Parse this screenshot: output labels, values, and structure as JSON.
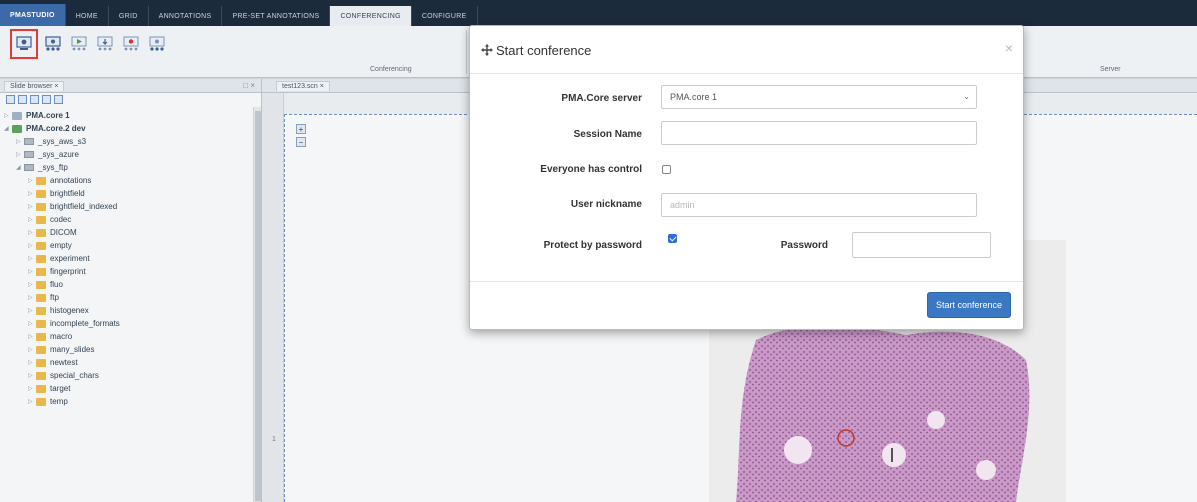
{
  "menu": {
    "brand": "PMASTUDIO",
    "tabs": [
      "HOME",
      "GRID",
      "ANNOTATIONS",
      "PRE-SET ANNOTATIONS",
      "CONFERENCING",
      "CONFIGURE"
    ],
    "active_tab": "CONFERENCING"
  },
  "ribbon": {
    "group_label": "Conferencing",
    "server_label": "Server",
    "buttons": [
      "start-conference-icon",
      "join-conference-icon",
      "present-icon",
      "follow-icon",
      "record-icon",
      "participants-icon"
    ]
  },
  "slide_browser": {
    "tab_label": "Slide browser",
    "close": "×",
    "panel_ctrl": "□ ×",
    "tree": [
      {
        "label": "PMA.core 1",
        "kind": "server",
        "level": 0,
        "bold": true,
        "expanded": false
      },
      {
        "label": "PMA.core.2 dev",
        "kind": "server-green",
        "level": 0,
        "bold": true,
        "expanded": true
      },
      {
        "label": "_sys_aws_s3",
        "kind": "drive",
        "level": 1
      },
      {
        "label": "_sys_azure",
        "kind": "drive",
        "level": 1
      },
      {
        "label": "_sys_ftp",
        "kind": "drive",
        "level": 1,
        "expanded": true
      },
      {
        "label": "annotations",
        "kind": "folder",
        "level": 2
      },
      {
        "label": "brightfield",
        "kind": "folder",
        "level": 2
      },
      {
        "label": "brightfield_indexed",
        "kind": "folder",
        "level": 2
      },
      {
        "label": "codec",
        "kind": "folder",
        "level": 2
      },
      {
        "label": "DICOM",
        "kind": "folder",
        "level": 2
      },
      {
        "label": "empty",
        "kind": "folder",
        "level": 2
      },
      {
        "label": "experiment",
        "kind": "folder",
        "level": 2
      },
      {
        "label": "fingerprint",
        "kind": "folder",
        "level": 2
      },
      {
        "label": "fluo",
        "kind": "folder",
        "level": 2
      },
      {
        "label": "ftp",
        "kind": "folder",
        "level": 2
      },
      {
        "label": "histogenex",
        "kind": "folder",
        "level": 2
      },
      {
        "label": "incomplete_formats",
        "kind": "folder",
        "level": 2
      },
      {
        "label": "macro",
        "kind": "folder",
        "level": 2
      },
      {
        "label": "many_slides",
        "kind": "folder",
        "level": 2
      },
      {
        "label": "newtest",
        "kind": "folder",
        "level": 2
      },
      {
        "label": "special_chars",
        "kind": "folder",
        "level": 2
      },
      {
        "label": "target",
        "kind": "folder",
        "level": 2
      },
      {
        "label": "temp",
        "kind": "folder",
        "level": 2
      }
    ]
  },
  "viewer": {
    "tab_label": "test123.scn",
    "zoom_in": "+",
    "zoom_out": "−",
    "ruler_mark": "1"
  },
  "modal": {
    "title": "Start conference",
    "close": "×",
    "server_label": "PMA.Core server",
    "server_value": "PMA.core 1",
    "session_label": "Session Name",
    "session_value": "",
    "control_label": "Everyone has control",
    "control_checked": false,
    "nickname_label": "User nickname",
    "nickname_placeholder": "admin",
    "protect_label": "Protect by password",
    "protect_checked": true,
    "password_label": "Password",
    "password_value": "",
    "submit_label": "Start conference"
  }
}
